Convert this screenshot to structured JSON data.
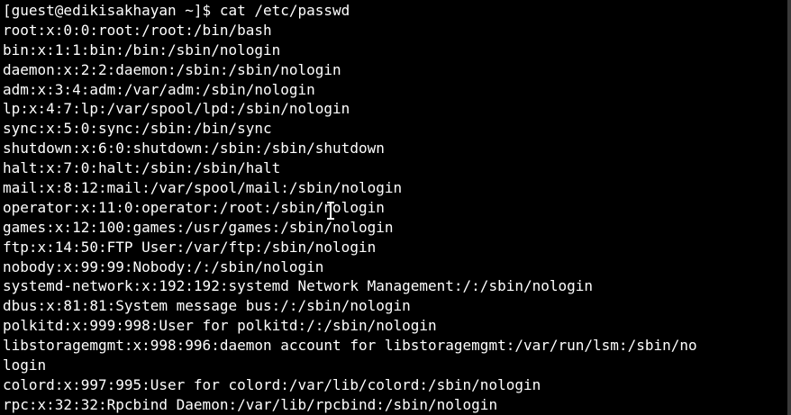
{
  "terminal": {
    "prompt": "[guest@edikisakhayan ~]$ cat /etc/passwd",
    "lines": [
      "root:x:0:0:root:/root:/bin/bash",
      "bin:x:1:1:bin:/bin:/sbin/nologin",
      "daemon:x:2:2:daemon:/sbin:/sbin/nologin",
      "adm:x:3:4:adm:/var/adm:/sbin/nologin",
      "lp:x:4:7:lp:/var/spool/lpd:/sbin/nologin",
      "sync:x:5:0:sync:/sbin:/bin/sync",
      "shutdown:x:6:0:shutdown:/sbin:/sbin/shutdown",
      "halt:x:7:0:halt:/sbin:/sbin/halt",
      "mail:x:8:12:mail:/var/spool/mail:/sbin/nologin",
      "operator:x:11:0:operator:/root:/sbin/nologin",
      "games:x:12:100:games:/usr/games:/sbin/nologin",
      "ftp:x:14:50:FTP User:/var/ftp:/sbin/nologin",
      "nobody:x:99:99:Nobody:/:/sbin/nologin",
      "systemd-network:x:192:192:systemd Network Management:/:/sbin/nologin",
      "dbus:x:81:81:System message bus:/:/sbin/nologin",
      "polkitd:x:999:998:User for polkitd:/:/sbin/nologin",
      "libstoragemgmt:x:998:996:daemon account for libstoragemgmt:/var/run/lsm:/sbin/no",
      "login",
      "colord:x:997:995:User for colord:/var/lib/colord:/sbin/nologin",
      "rpc:x:32:32:Rpcbind Daemon:/var/lib/rpcbind:/sbin/nologin"
    ]
  },
  "colors": {
    "background": "#000000",
    "foreground": "#ffffff"
  },
  "icons": {
    "cursor": "text-cursor-icon"
  }
}
